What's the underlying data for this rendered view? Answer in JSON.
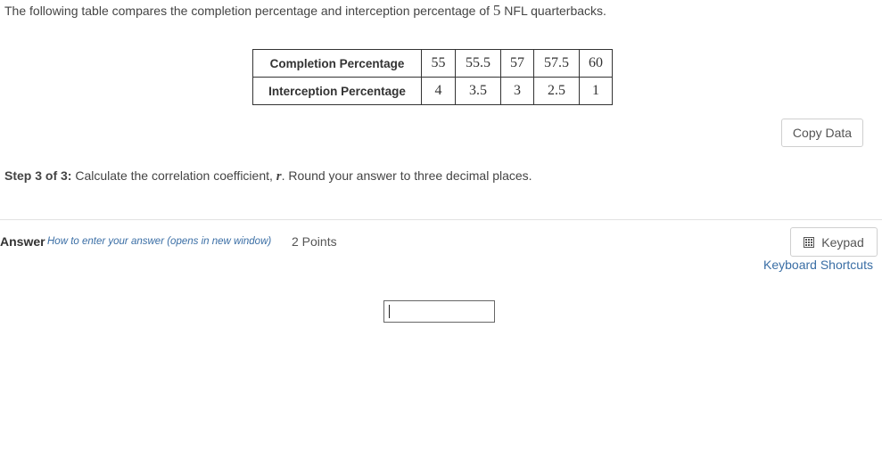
{
  "intro": {
    "before": "The following table compares the completion percentage and interception percentage of ",
    "count": "5",
    "after": " NFL quarterbacks."
  },
  "table": {
    "rows": [
      {
        "header": "Completion Percentage",
        "values": [
          "55",
          "55.5",
          "57",
          "57.5",
          "60"
        ]
      },
      {
        "header": "Interception Percentage",
        "values": [
          "4",
          "3.5",
          "3",
          "2.5",
          "1"
        ]
      }
    ]
  },
  "copy_data_label": "Copy Data",
  "step": {
    "label": "Step 3 of 3:",
    "text_before": " Calculate the correlation coefficient, ",
    "variable": "r",
    "text_after": ". Round your answer to three decimal places."
  },
  "answer": {
    "label": "Answer",
    "howto_link": "How to enter your answer (opens in new window)",
    "points": "2 Points",
    "input_value": ""
  },
  "keypad_label": "Keypad",
  "keyboard_shortcuts_label": "Keyboard Shortcuts"
}
